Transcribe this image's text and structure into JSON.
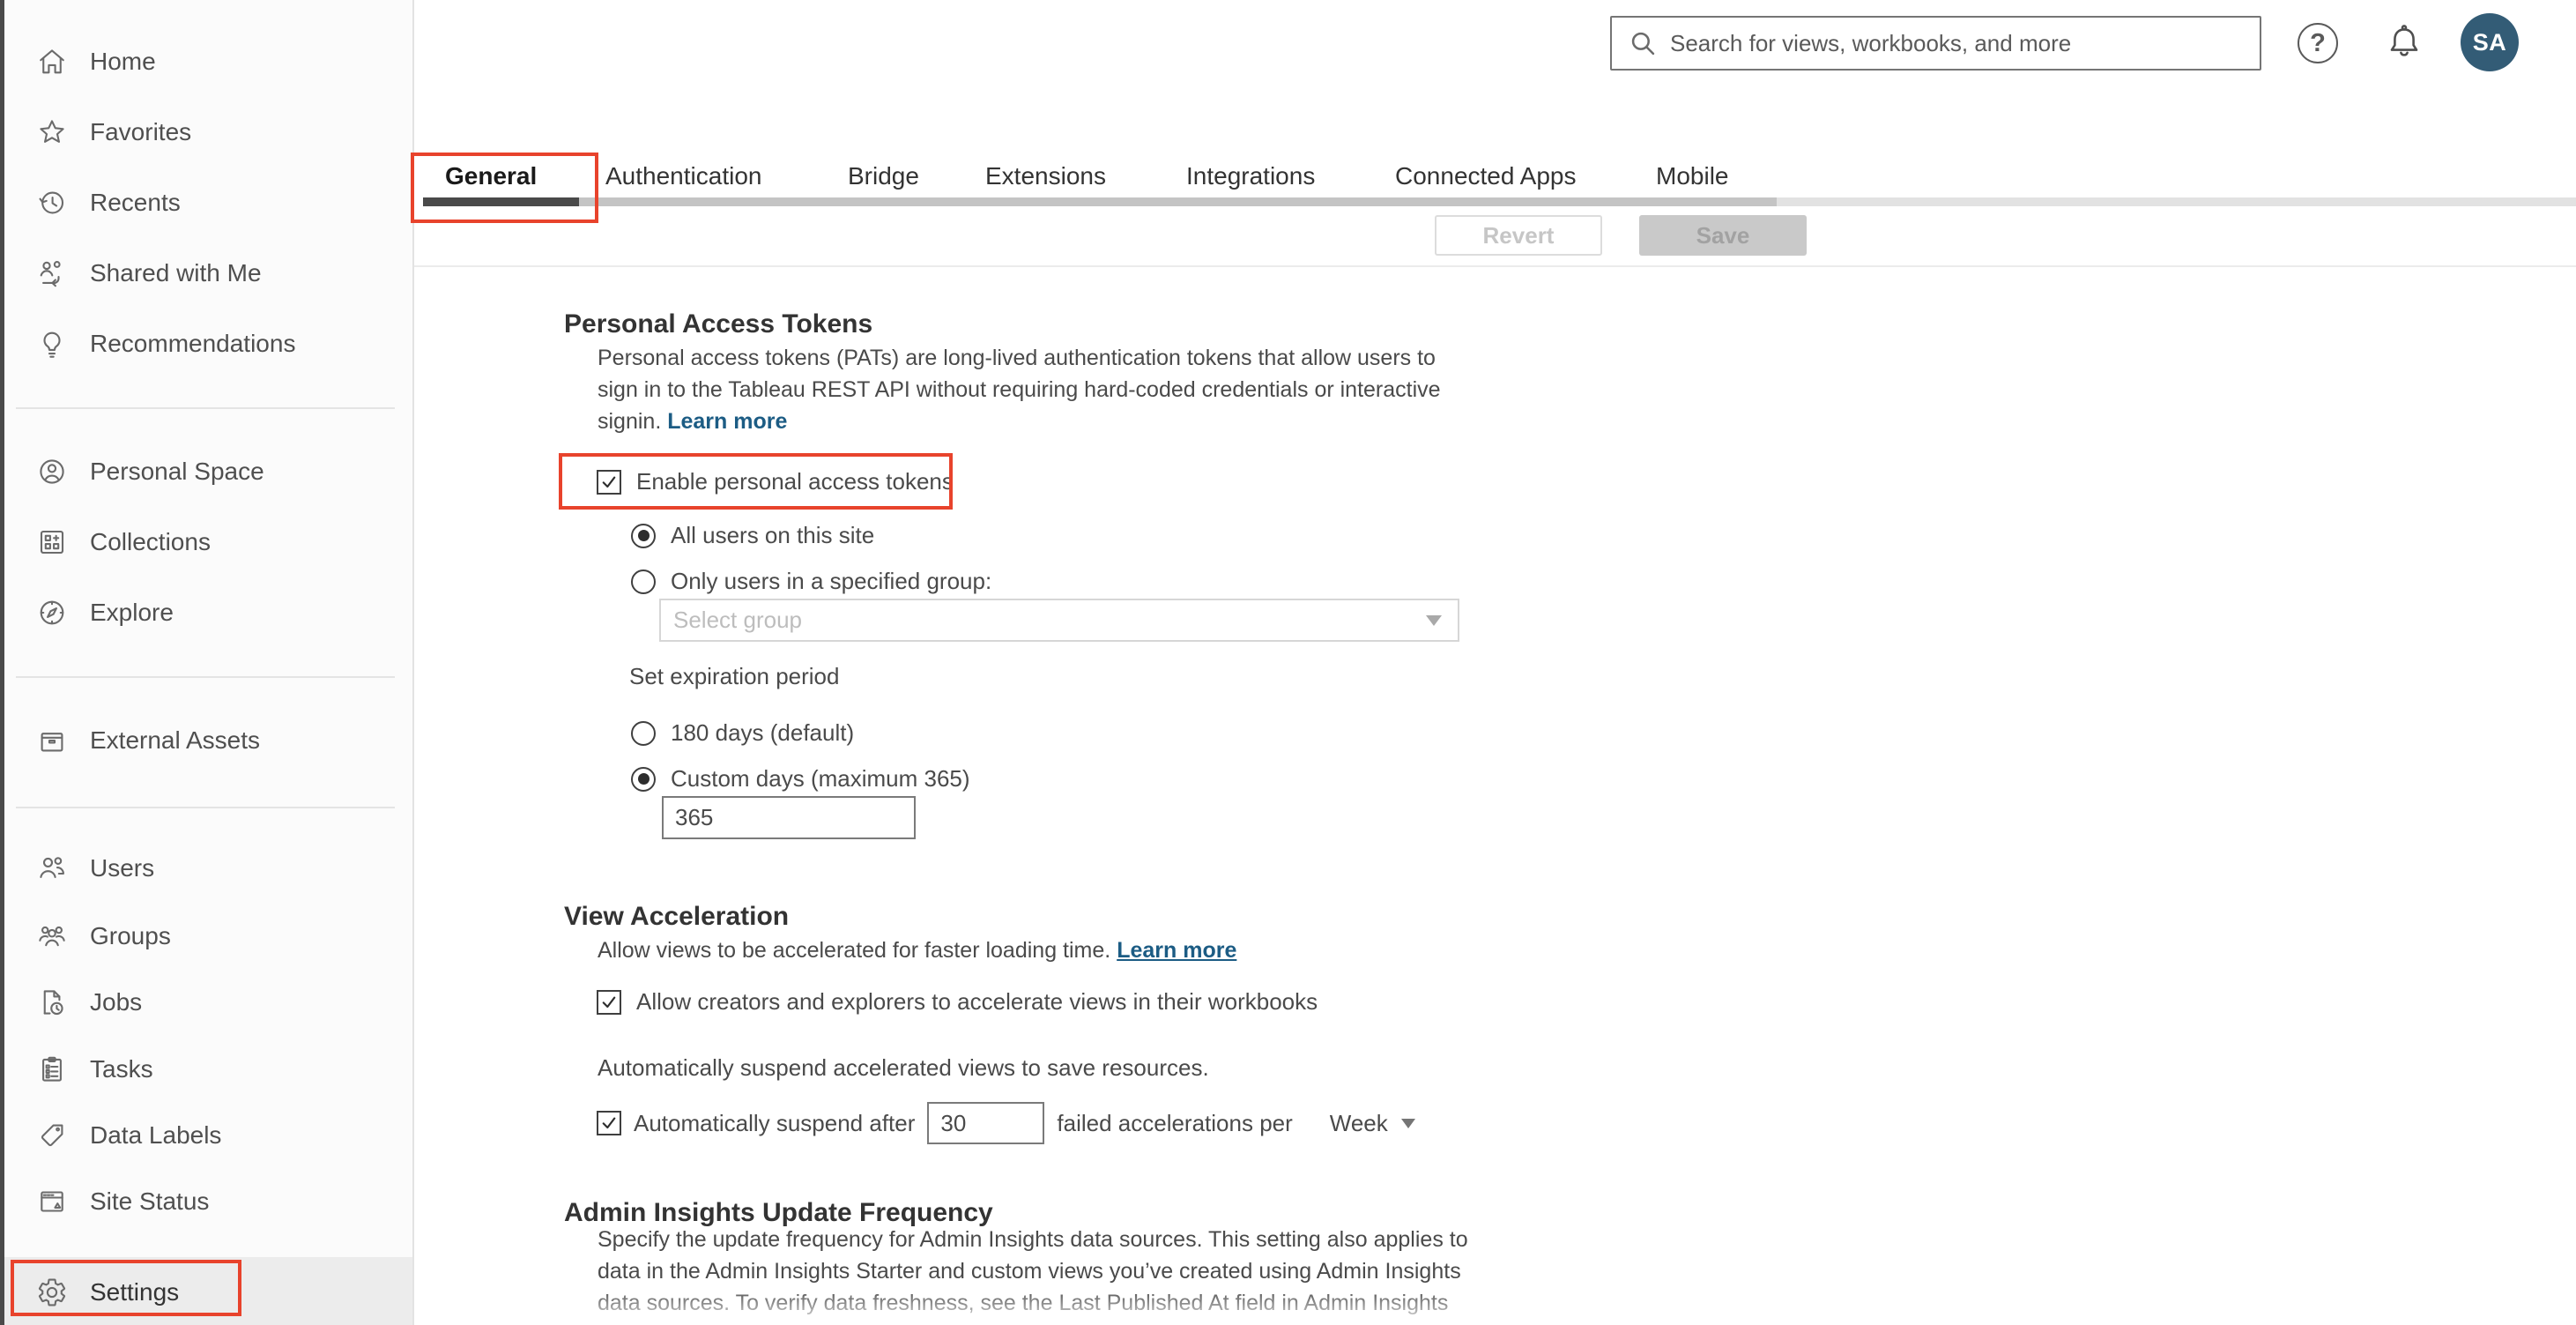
{
  "header": {
    "search_placeholder": "Search for views, workbooks, and more",
    "help_glyph": "?",
    "avatar_initials": "SA"
  },
  "tabs": {
    "items": [
      {
        "label": "General",
        "active": true
      },
      {
        "label": "Authentication",
        "active": false
      },
      {
        "label": "Bridge",
        "active": false
      },
      {
        "label": "Extensions",
        "active": false
      },
      {
        "label": "Integrations",
        "active": false
      },
      {
        "label": "Connected Apps",
        "active": false
      },
      {
        "label": "Mobile",
        "active": false
      }
    ],
    "revert_label": "Revert",
    "save_label": "Save"
  },
  "sidebar": {
    "groups": [
      {
        "items": [
          {
            "icon": "home-icon",
            "label": "Home"
          },
          {
            "icon": "star-icon",
            "label": "Favorites"
          },
          {
            "icon": "recents-icon",
            "label": "Recents"
          },
          {
            "icon": "shared-icon",
            "label": "Shared with Me"
          },
          {
            "icon": "lightbulb-icon",
            "label": "Recommendations"
          }
        ]
      },
      {
        "items": [
          {
            "icon": "person-circle-icon",
            "label": "Personal Space"
          },
          {
            "icon": "collections-icon",
            "label": "Collections"
          },
          {
            "icon": "compass-icon",
            "label": "Explore"
          }
        ]
      },
      {
        "items": [
          {
            "icon": "archive-icon",
            "label": "External Assets"
          }
        ]
      },
      {
        "items": [
          {
            "icon": "users-icon",
            "label": "Users"
          },
          {
            "icon": "groups-icon",
            "label": "Groups"
          },
          {
            "icon": "jobs-icon",
            "label": "Jobs"
          },
          {
            "icon": "tasks-icon",
            "label": "Tasks"
          },
          {
            "icon": "tag-icon",
            "label": "Data Labels"
          },
          {
            "icon": "site-status-icon",
            "label": "Site Status"
          },
          {
            "icon": "gear-icon",
            "label": "Settings",
            "selected": true
          }
        ]
      }
    ]
  },
  "settings_page": {
    "pat": {
      "title": "Personal Access Tokens",
      "description": "Personal access tokens (PATs) are long-lived authentication tokens that allow users to sign in to the Tableau REST API without requiring hard-coded credentials or interactive signin.",
      "learn_more": "Learn more",
      "enable_label": "Enable personal access tokens",
      "enable_checked": true,
      "scope_options": [
        {
          "label": "All users on this site",
          "selected": true
        },
        {
          "label": "Only users in a specified group:",
          "selected": false
        }
      ],
      "group_select_placeholder": "Select group",
      "expiration_label": "Set expiration period",
      "expiration_options": [
        {
          "label": "180 days (default)",
          "selected": false
        },
        {
          "label": "Custom days (maximum 365)",
          "selected": true
        }
      ],
      "custom_days_value": "365"
    },
    "view_acceleration": {
      "title": "View Acceleration",
      "description": "Allow views to be accelerated for faster loading time.",
      "learn_more": "Learn more",
      "allow_label": "Allow creators and explorers to accelerate views in their workbooks",
      "allow_checked": true,
      "suspend_description": "Automatically suspend accelerated views to save resources.",
      "suspend_checked": true,
      "suspend_prefix": "Automatically suspend after",
      "suspend_value": "30",
      "suspend_suffix": "failed accelerations per",
      "suspend_period": "Week"
    },
    "admin_insights": {
      "title": "Admin Insights Update Frequency",
      "description": "Specify the update frequency for Admin Insights data sources. This setting also applies to data in the Admin Insights Starter and custom views you’ve created using Admin Insights data sources. To verify data freshness, see the Last Published At field in Admin Insights"
    }
  },
  "colors": {
    "annotation": "#e8432c",
    "link": "#1c5c84",
    "avatar_bg": "#335c76",
    "tab_indicator": "#4a4a4a"
  }
}
